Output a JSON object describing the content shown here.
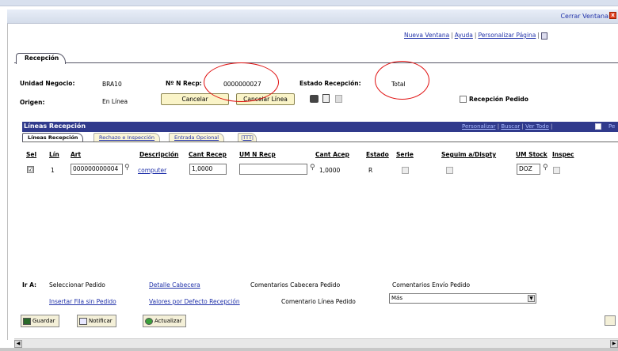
{
  "window": {
    "close_label": "Cerrar Ventana"
  },
  "top_links": {
    "new_window": "Nueva Ventana",
    "help": "Ayuda",
    "customize": "Personalizar Página",
    "sep": "|"
  },
  "page_tab": "Recepción",
  "header": {
    "unit_label": "Unidad Negocio:",
    "unit_value": "BRA10",
    "receipt_label": "Nº N Recp:",
    "receipt_value": "0000000027",
    "status_label": "Estado Recepción:",
    "status_value": "Total",
    "origin_label": "Origen:",
    "origin_value": "En Línea",
    "cancel_button": "Cancelar",
    "cancel_line_button": "Cancelar Línea",
    "receipt_order_label": "Recepción Pedido"
  },
  "grid": {
    "title": "Líneas Recepción",
    "links": {
      "customize": "Personalizar",
      "search": "Buscar",
      "view_all": "Ver Todo"
    },
    "pe": "Pe",
    "subtabs": [
      "Líneas Recepción",
      "Rechazo e Inspección",
      "Entrada Opcional",
      "|TTT|"
    ],
    "columns": [
      "Sel",
      "Lín",
      "Art",
      "Descripción",
      "Cant Recep",
      "UM N Recp",
      "Cant Acep",
      "Estado",
      "Serie",
      "Seguim a/Dispty",
      "UM Stock",
      "Inspec"
    ],
    "rows": [
      {
        "sel": "☑",
        "line": "1",
        "item": "000000000004",
        "description": "computer",
        "qty_recv": "1,0000",
        "uom_recv": "",
        "qty_acc": "1,0000",
        "status": "R",
        "uom_stock": "DOZ"
      }
    ]
  },
  "goto": {
    "label": "Ir A:",
    "links": [
      "Seleccionar Pedido",
      "Detalle Cabecera",
      "Comentarios Cabecera Pedido",
      "Comentarios Envío Pedido",
      "Insertar Fila sin Pedido",
      "Valores por Defecto Recepción",
      "Comentario Línea Pedido"
    ],
    "select_value": "Más"
  },
  "actions": {
    "save": "Guardar",
    "notify": "Notificar",
    "refresh": "Actualizar"
  },
  "colors": {
    "grid_header": "#303a8c",
    "button_bg": "#faf4c8",
    "annotation": "#e01010"
  }
}
